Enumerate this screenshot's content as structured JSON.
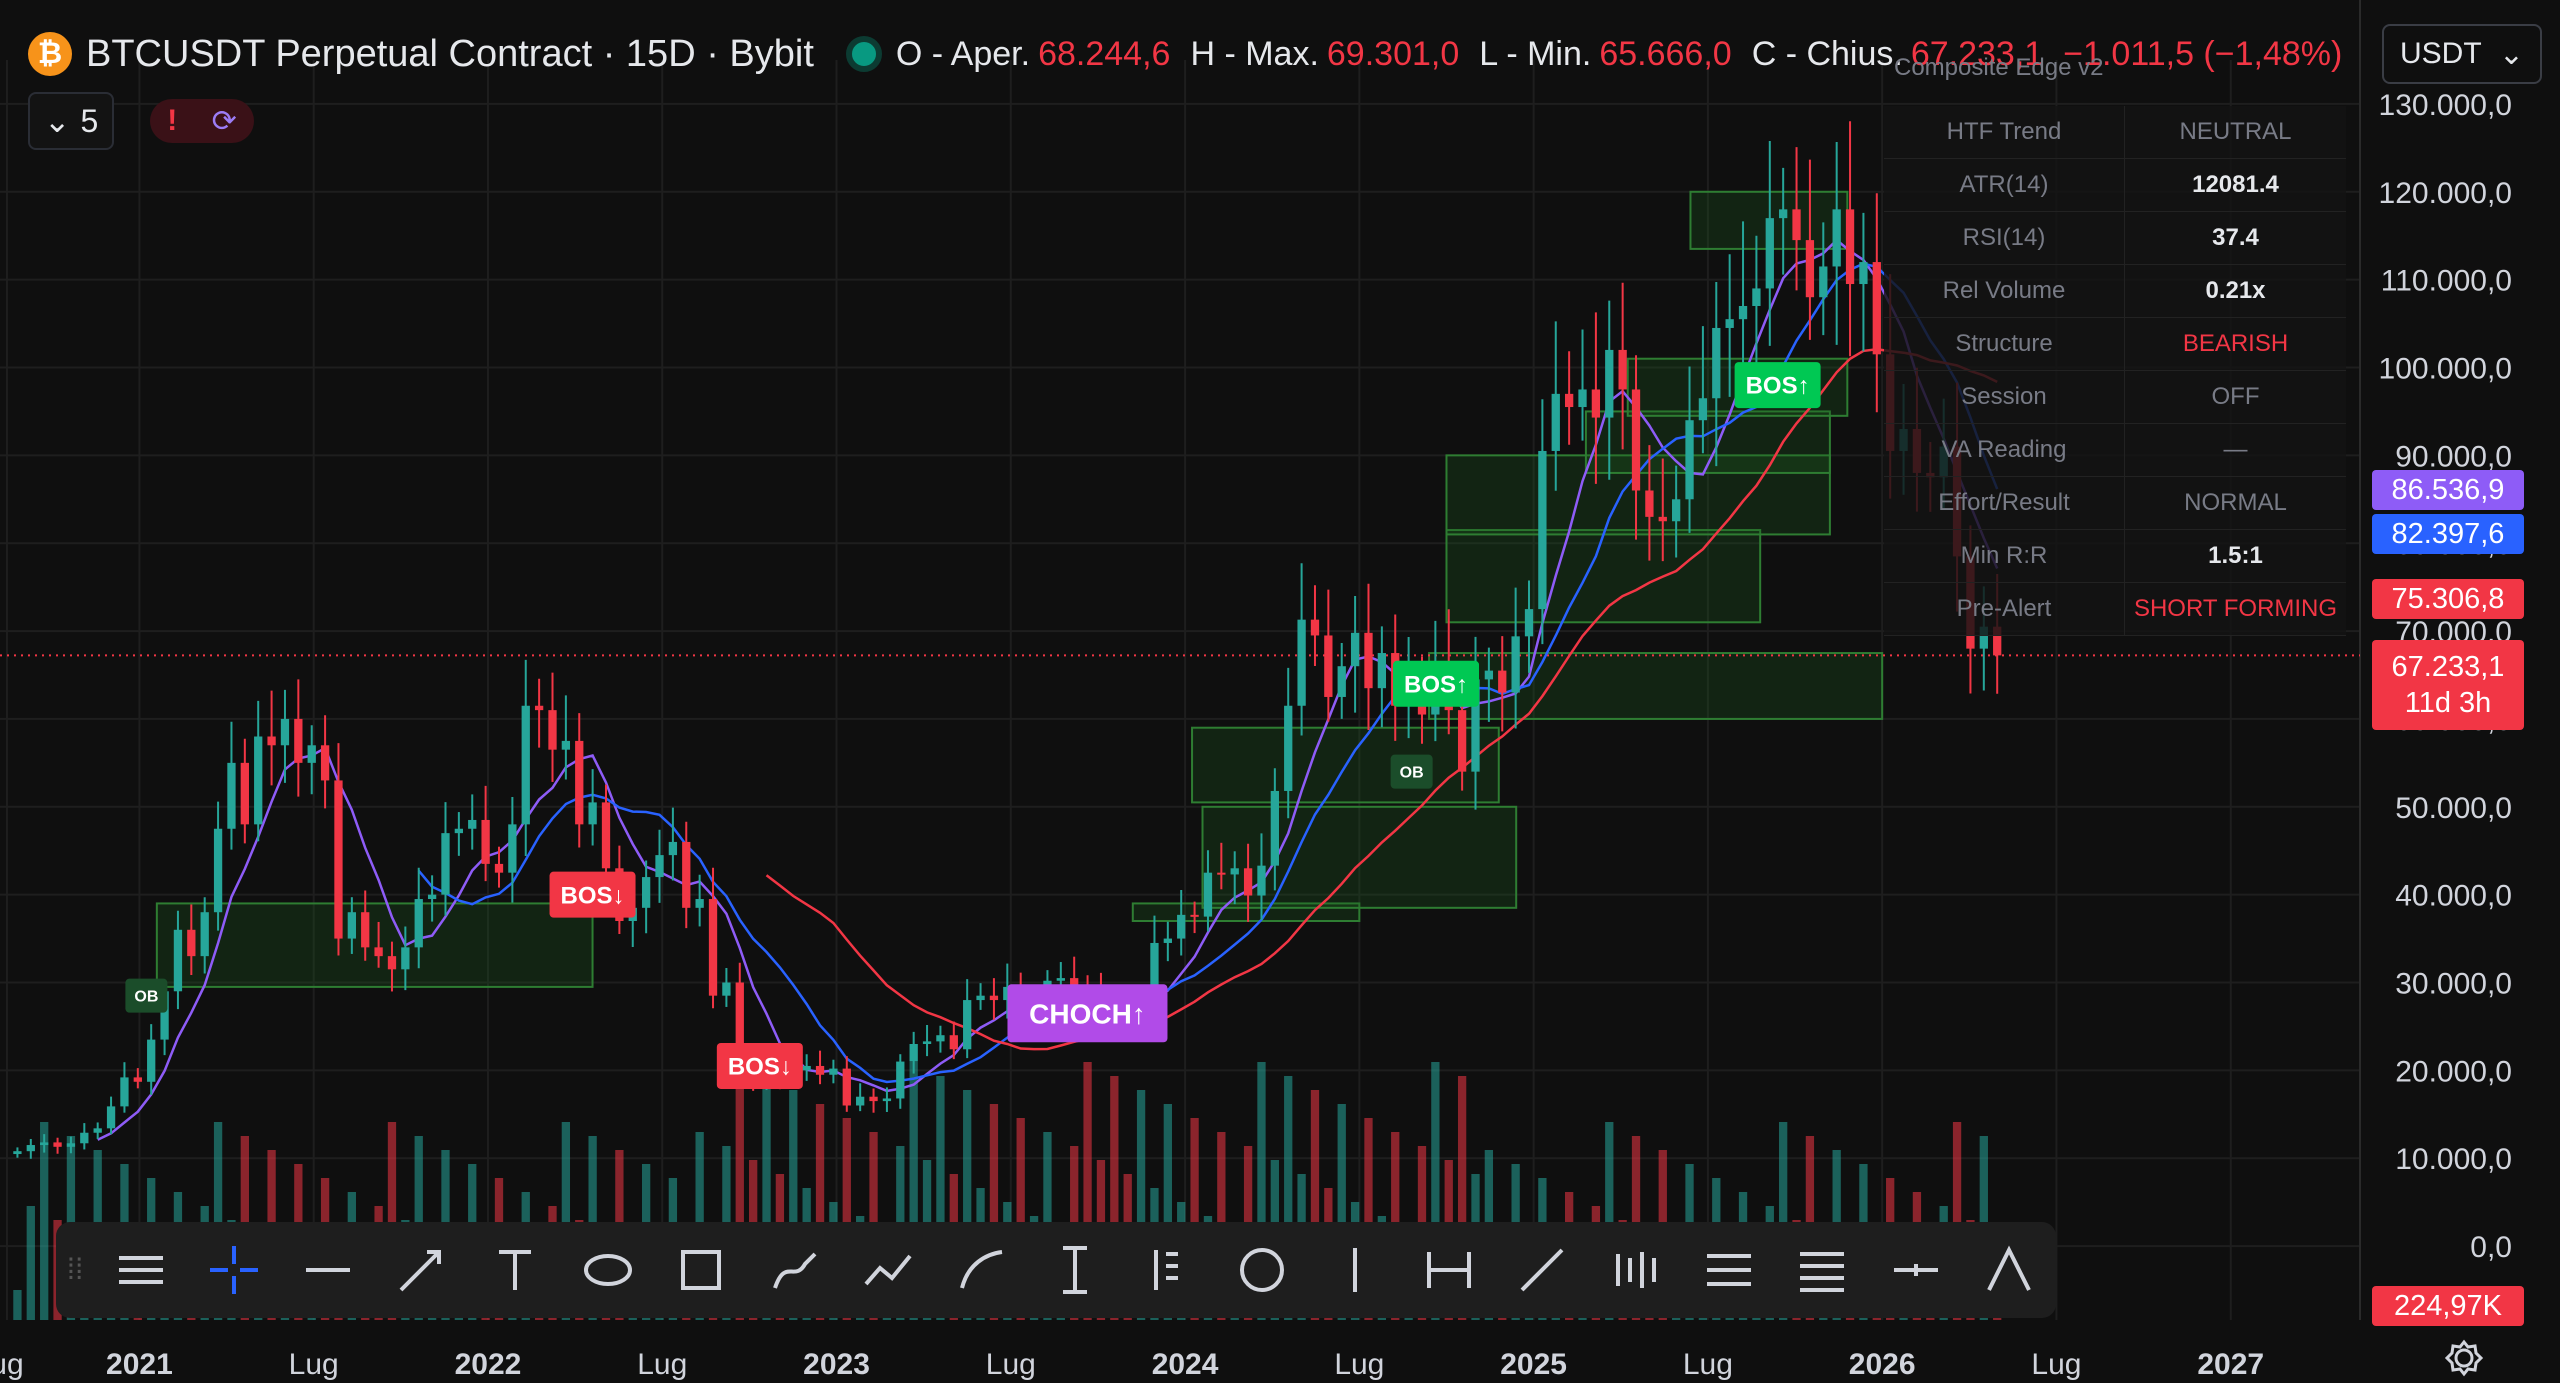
{
  "header": {
    "coin_symbol": "₿",
    "title": "BTCUSDT Perpetual Contract · 15D · Bybit",
    "ohlc": {
      "open_label": "O - Aper.",
      "open": "68.244,6",
      "high_label": "H - Max.",
      "high": "69.301,0",
      "low_label": "L - Min.",
      "low": "65.666,0",
      "close_label": "C - Chius.",
      "close": "67.233,1",
      "change": "−1.011,5 (−1,48%)"
    },
    "currency": "USDT",
    "collapse_count": "5",
    "alert_icon": "!",
    "sync_icon": "⟳"
  },
  "indicator_panel": {
    "title": "Composite Edge v2",
    "rows": [
      {
        "label": "HTF Trend",
        "value": "NEUTRAL"
      },
      {
        "label": "ATR(14)",
        "value": "12081.4"
      },
      {
        "label": "RSI(14)",
        "value": "37.4"
      },
      {
        "label": "Rel Volume",
        "value": "0.21x"
      },
      {
        "label": "Structure",
        "value": "BEARISH"
      },
      {
        "label": "Session",
        "value": "OFF"
      },
      {
        "label": "VA Reading",
        "value": "—"
      },
      {
        "label": "Effort/Result",
        "value": "NORMAL"
      },
      {
        "label": "Min R:R",
        "value": "1.5:1"
      },
      {
        "label": "Pre-Alert",
        "value": "SHORT FORMING"
      }
    ]
  },
  "price_tags": {
    "ma_fast": "86.536,9",
    "ma_mid": "82.397,6",
    "ma_slow": "75.306,8",
    "last_price": "67.233,1",
    "countdown": "11d 3h",
    "volume": "224,97K"
  },
  "colors": {
    "up": "#26a69a",
    "down": "#f23645",
    "ma_fast": "#8e5cf7",
    "ma_mid": "#2962ff",
    "ma_slow": "#f23645",
    "ob_zone": "#1b5e20"
  },
  "chart_data": {
    "type": "candlestick",
    "symbol": "BTCUSDT",
    "interval": "15D",
    "y_axis": {
      "ticks": [
        "0,0",
        "10.000,0",
        "20.000,0",
        "30.000,0",
        "40.000,0",
        "50.000,0",
        "60.000,0",
        "70.000,0",
        "80.000,0",
        "90.000,0",
        "100.000,0",
        "110.000,0",
        "120.000,0",
        "130.000,0"
      ],
      "range": [
        -5000,
        135000
      ]
    },
    "x_axis": {
      "ticks": [
        {
          "label": "ug",
          "t": 2020.62
        },
        {
          "label": "2021",
          "t": 2021.0
        },
        {
          "label": "Lug",
          "t": 2021.5
        },
        {
          "label": "2022",
          "t": 2022.0
        },
        {
          "label": "Lug",
          "t": 2022.5
        },
        {
          "label": "2023",
          "t": 2023.0
        },
        {
          "label": "Lug",
          "t": 2023.5
        },
        {
          "label": "2024",
          "t": 2024.0
        },
        {
          "label": "Lug",
          "t": 2024.5
        },
        {
          "label": "2025",
          "t": 2025.0
        },
        {
          "label": "Lug",
          "t": 2025.5
        },
        {
          "label": "2026",
          "t": 2026.0
        },
        {
          "label": "Lug",
          "t": 2026.5
        },
        {
          "label": "2027",
          "t": 2027.0
        }
      ],
      "range": [
        2020.6,
        2027.5
      ]
    },
    "candles_close": [
      10800,
      11500,
      11800,
      11300,
      11700,
      12900,
      13400,
      15900,
      19200,
      18700,
      23500,
      29000,
      36000,
      33000,
      38000,
      47500,
      55000,
      48000,
      58000,
      57000,
      60000,
      55000,
      57000,
      53000,
      35000,
      38000,
      34000,
      33000,
      31500,
      34000,
      39500,
      40000,
      47000,
      47500,
      48500,
      43500,
      42500,
      48000,
      61500,
      61000,
      56500,
      57500,
      48000,
      50500,
      43000,
      37000,
      38500,
      42000,
      44500,
      46000,
      38500,
      39500,
      28500,
      30000,
      21000,
      19200,
      20500,
      19200,
      20000,
      20500,
      19500,
      20200,
      16000,
      17000,
      16500,
      16800,
      21000,
      23000,
      23300,
      24000,
      22400,
      28000,
      28500,
      28000,
      29500,
      27000,
      27000,
      30200,
      30500,
      29500,
      29200,
      26100,
      26000,
      25900,
      27000,
      34500,
      35000,
      37700,
      37500,
      42500,
      42300,
      43000,
      39900,
      43300,
      51800,
      61500,
      71300,
      69500,
      62500,
      66000,
      69800,
      63500,
      67500,
      61500,
      63900,
      60500,
      66500,
      61000,
      54000,
      64500,
      65500,
      63000,
      69400,
      72500,
      90500,
      97000,
      95500,
      97500,
      94300,
      102000,
      97500,
      86000,
      83000,
      82500,
      85000,
      94000,
      96500,
      104500,
      105500,
      107000,
      109000,
      117000,
      118000,
      114500,
      108000,
      111500,
      118000,
      109500,
      112000,
      101500,
      90500,
      93000,
      88000,
      87500,
      91000,
      78500,
      68000,
      70500,
      67233
    ],
    "moving_averages": [
      {
        "name": "MA fast",
        "last": 86536.9
      },
      {
        "name": "MA mid",
        "last": 82397.6
      },
      {
        "name": "MA slow",
        "last": 75306.8
      }
    ],
    "annotations": [
      {
        "label": "BOS↓",
        "type": "bearish",
        "t": 2022.3,
        "price": 40000
      },
      {
        "label": "BOS↓",
        "type": "bearish",
        "t": 2022.78,
        "price": 20500
      },
      {
        "label": "CHOCH↑",
        "type": "bullish-choch",
        "t": 2023.72,
        "price": 26500
      },
      {
        "label": "BOS↑",
        "type": "bullish",
        "t": 2024.72,
        "price": 64000
      },
      {
        "label": "BOS↑",
        "type": "bullish",
        "t": 2025.7,
        "price": 98000
      },
      {
        "label": "OB",
        "type": "ob",
        "t": 2021.02,
        "price": 28500
      },
      {
        "label": "OB",
        "type": "ob",
        "t": 2024.65,
        "price": 54000
      }
    ],
    "order_blocks": [
      {
        "t0": 2021.05,
        "t1": 2022.3,
        "low": 29500,
        "high": 39000
      },
      {
        "t0": 2023.85,
        "t1": 2024.5,
        "low": 37000,
        "high": 39000
      },
      {
        "t0": 2024.05,
        "t1": 2024.95,
        "low": 38500,
        "high": 50000
      },
      {
        "t0": 2024.02,
        "t1": 2024.9,
        "low": 50500,
        "high": 59000
      },
      {
        "t0": 2024.7,
        "t1": 2026.0,
        "low": 60000,
        "high": 67500
      },
      {
        "t0": 2024.75,
        "t1": 2025.65,
        "low": 71000,
        "high": 81500
      },
      {
        "t0": 2024.75,
        "t1": 2025.85,
        "low": 81000,
        "high": 90000
      },
      {
        "t0": 2025.15,
        "t1": 2025.85,
        "low": 88000,
        "high": 95000
      },
      {
        "t0": 2025.27,
        "t1": 2025.9,
        "low": 94500,
        "high": 101000
      },
      {
        "t0": 2025.45,
        "t1": 2025.9,
        "low": 113500,
        "high": 120000
      }
    ],
    "volume_label": "224,97K"
  },
  "toolbar": {
    "tools": [
      "lines-tool",
      "crosshair-tool",
      "horizontal-line-tool",
      "arrow-line-tool",
      "text-tool",
      "ellipse-tool",
      "rectangle-tool",
      "brush-tool",
      "path-tool",
      "curve-tool",
      "long-position-tool",
      "pitchfork-tool",
      "circle-tool",
      "vertical-line-tool",
      "date-range-tool",
      "trend-line-tool",
      "price-range-tool",
      "fib-tool",
      "fib-channel-tool",
      "anchored-vwap-tool",
      "angle-tool"
    ]
  }
}
